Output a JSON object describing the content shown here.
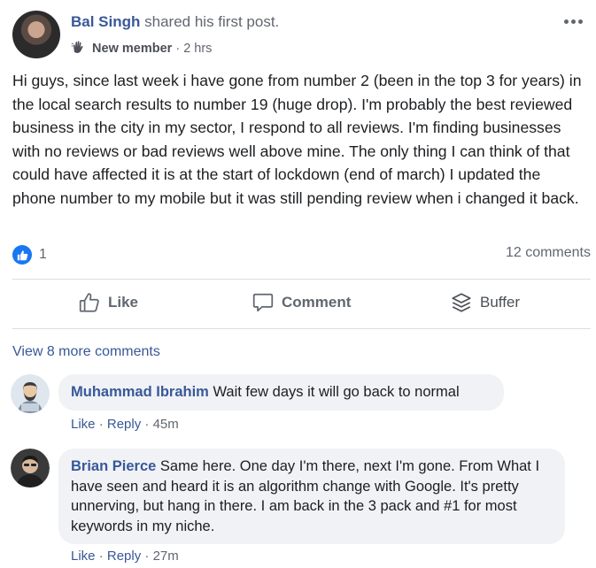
{
  "post": {
    "author": "Bal Singh",
    "action_text": "shared his first post.",
    "badge": "New member",
    "time": "2 hrs",
    "body": "Hi guys, since last week i have gone from number 2 (been in the top 3 for years) in the local search results to number 19 (huge drop). I'm probably the best reviewed business in the city in my sector, I respond to all reviews. I'm finding businesses with no reviews or bad reviews well above mine. The only thing I can think of that could have affected it is at the start of lockdown (end of march) I updated the phone number to my mobile but it was still pending review when i changed it back.",
    "reaction_count": "1",
    "comments_count": "12 comments"
  },
  "actions": {
    "like": "Like",
    "comment": "Comment",
    "buffer": "Buffer"
  },
  "view_more": "View 8 more comments",
  "comments": [
    {
      "name": "Muhammad Ibrahim",
      "text": "Wait few days it will go back to normal",
      "like": "Like",
      "reply": "Reply",
      "time": "45m"
    },
    {
      "name": "Brian Pierce",
      "text": "Same here. One day I'm there, next I'm gone. From What I have seen and heard it is an algorithm change with Google. It's pretty unnerving, but hang in there. I am back in the 3 pack and #1 for most keywords in my niche.",
      "like": "Like",
      "reply": "Reply",
      "time": "27m"
    }
  ],
  "colors": {
    "link": "#385898",
    "like_blue": "#1877f2",
    "bubble": "#f0f2f5",
    "secondary_text": "#606770"
  },
  "icons": [
    "wave-icon",
    "more-icon",
    "like-icon",
    "comment-icon",
    "buffer-icon",
    "thumbs-up-icon"
  ]
}
